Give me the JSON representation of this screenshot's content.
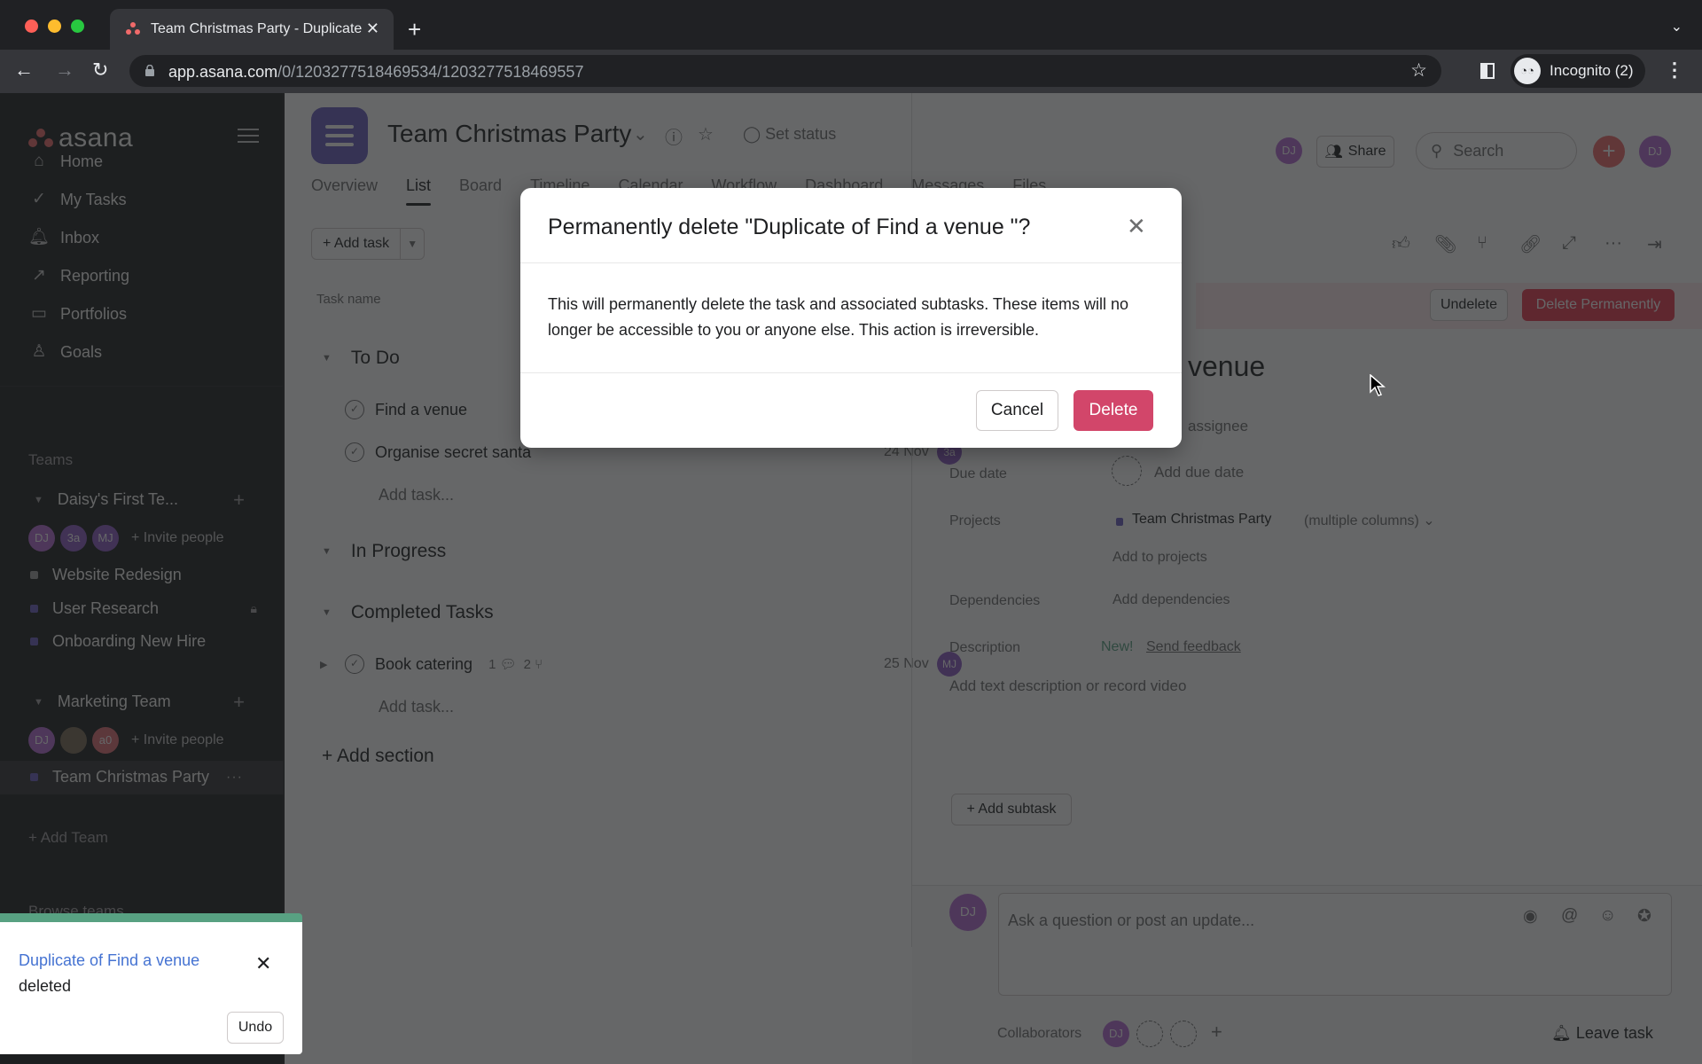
{
  "browser": {
    "tab_title": "Team Christmas Party - Duplicate of Find a venue",
    "url_host": "app.asana.com",
    "url_path": "/0/1203277518469534/1203277518469557",
    "profile_label": "Incognito (2)",
    "traffic_colors": [
      "#ff5f57",
      "#febc2e",
      "#28c840"
    ]
  },
  "sidebar": {
    "logo_text": "asana",
    "nav": [
      {
        "label": "Home",
        "icon": "home-icon"
      },
      {
        "label": "My Tasks",
        "icon": "check-circle-icon"
      },
      {
        "label": "Inbox",
        "icon": "bell-icon"
      },
      {
        "label": "Reporting",
        "icon": "chart-line-icon"
      },
      {
        "label": "Portfolios",
        "icon": "folder-icon"
      },
      {
        "label": "Goals",
        "icon": "person-icon"
      }
    ],
    "teams_label": "Teams",
    "teams": [
      {
        "name": "Daisy's First Te...",
        "members": [
          {
            "initials": "DJ",
            "color": "#b36bd4"
          },
          {
            "initials": "3a",
            "color": "#8d5bc5"
          },
          {
            "initials": "MJ",
            "color": "#8d5bc5"
          }
        ],
        "invite_label": "+ Invite people",
        "projects": [
          {
            "name": "Website Redesign",
            "color": "#9e9e9e",
            "locked": false
          },
          {
            "name": "User Research",
            "color": "#6a5fc1",
            "locked": true
          },
          {
            "name": "Onboarding New Hire",
            "color": "#6a5fc1",
            "locked": false
          }
        ]
      },
      {
        "name": "Marketing Team",
        "members": [
          {
            "initials": "DJ",
            "color": "#b36bd4"
          },
          {
            "initials": "",
            "color": "#7a6a55"
          },
          {
            "initials": "a0",
            "color": "#e06c75"
          }
        ],
        "invite_label": "+ Invite people",
        "projects": [
          {
            "name": "Team Christmas Party",
            "color": "#6a5fc1",
            "locked": false,
            "active": true
          }
        ]
      }
    ],
    "add_team_label": "+ Add Team",
    "browse_teams_label": "Browse teams"
  },
  "header": {
    "project_title": "Team Christmas Party",
    "set_status_label": "Set status",
    "tabs": [
      "Overview",
      "List",
      "Board",
      "Timeline",
      "Calendar",
      "Workflow",
      "Dashboard",
      "Messages",
      "Files"
    ],
    "active_tab": "List",
    "share_label": "Share",
    "search_placeholder": "Search",
    "user_initials": "DJ"
  },
  "list": {
    "add_task_label": "+ Add task",
    "column_task_name": "Task name",
    "sections": [
      {
        "name": "To Do",
        "tasks": [
          {
            "name": "Find a venue",
            "due": "",
            "assignee": ""
          },
          {
            "name": "Organise secret santa",
            "due": "24 Nov",
            "assignee": "3a"
          }
        ]
      },
      {
        "name": "In Progress",
        "tasks": []
      },
      {
        "name": "Completed Tasks",
        "tasks": [
          {
            "name": "Book catering",
            "comments": "1",
            "subtasks": "2",
            "due": "25 Nov",
            "assignee": "MJ"
          }
        ]
      }
    ],
    "add_task_row_label": "Add task...",
    "add_section_label": "+ Add section"
  },
  "detail": {
    "undelete_label": "Undelete",
    "delete_permanently_label": "Delete Permanently",
    "title_visible": "venue",
    "assignee_visible": "assignee",
    "due_date_label": "Due date",
    "due_date_value": "Add due date",
    "projects_label": "Projects",
    "project_name": "Team Christmas Party",
    "project_column": "(multiple columns)",
    "add_to_projects": "Add to projects",
    "dependencies_label": "Dependencies",
    "dependencies_value": "Add dependencies",
    "description_label": "Description",
    "new_tag": "New!",
    "send_feedback": "Send feedback",
    "description_placeholder": "Add text description or record video",
    "add_subtask_label": "+ Add subtask",
    "comment_placeholder": "Ask a question or post an update...",
    "collaborators_label": "Collaborators",
    "collaborator_initials": "DJ",
    "leave_task_label": "Leave task"
  },
  "modal": {
    "title": "Permanently delete \"Duplicate of Find a venue \"?",
    "body": "This will permanently delete the task and associated subtasks. These items will no longer be accessible to you or anyone else. This action is irreversible.",
    "cancel_label": "Cancel",
    "delete_label": "Delete",
    "delete_color": "#d2466a"
  },
  "toast": {
    "link_text": "Duplicate of Find a venue",
    "message": "deleted",
    "undo_label": "Undo",
    "accent_color": "#58a182"
  }
}
